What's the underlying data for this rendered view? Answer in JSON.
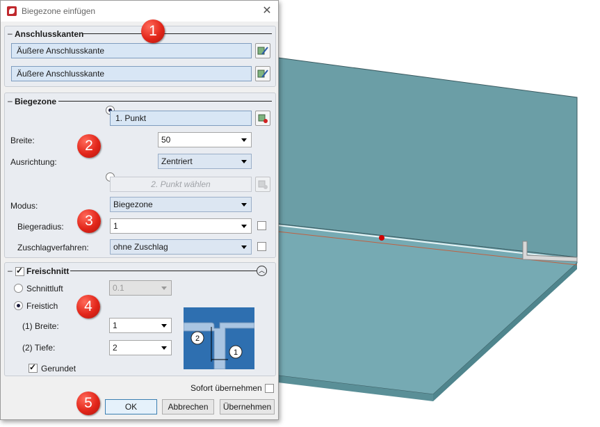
{
  "dialog": {
    "title": "Biegezone einfügen",
    "close_symbol": "✕"
  },
  "anschluss": {
    "title": "Anschlusskanten",
    "edge1": "Äußere Anschlusskante",
    "edge2": "Äußere Anschlusskante"
  },
  "biegezone": {
    "title": "Biegezone",
    "point1": "1. Punkt",
    "breite_label": "Breite:",
    "breite_value": "50",
    "ausrichtung_label": "Ausrichtung:",
    "ausrichtung_value": "Zentriert",
    "point2": "2. Punkt wählen",
    "modus_label": "Modus:",
    "modus_value": "Biegezone",
    "radius_label": "Biegeradius:",
    "radius_value": "1",
    "zuschlag_label": "Zuschlagverfahren:",
    "zuschlag_value": "ohne Zuschlag"
  },
  "freischnitt": {
    "title": "Freischnitt",
    "checked": true,
    "schnittluft_label": "Schnittluft",
    "schnittluft_value": "0.1",
    "freistich_label": "Freistich",
    "breite_label": "(1) Breite:",
    "breite_value": "1",
    "tiefe_label": "(2) Tiefe:",
    "tiefe_value": "2",
    "gerundet_label": "Gerundet",
    "diagram_label_1": "1",
    "diagram_label_2": "2"
  },
  "footer": {
    "sofort_label": "Sofort übernehmen",
    "ok_label": "OK",
    "abbrechen_label": "Abbrechen",
    "uebernehmen_label": "Übernehmen"
  },
  "badges": [
    "1",
    "2",
    "3",
    "4",
    "5"
  ],
  "colors": {
    "badge": "#e2261a",
    "sheet_top": "#6fa4ad",
    "sheet_front": "#5f9aa3",
    "diagram_bg": "#2e6fb0"
  }
}
